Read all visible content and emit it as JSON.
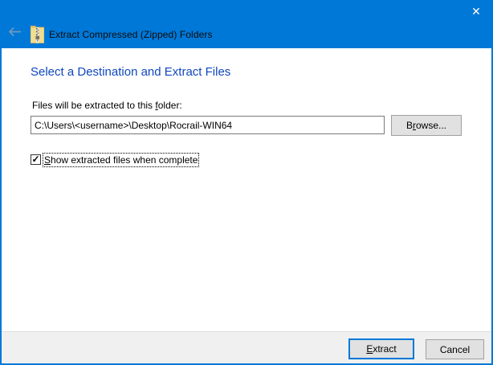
{
  "window": {
    "title": "Extract Compressed (Zipped) Folders",
    "icons": {
      "close_glyph": "✕",
      "check_glyph": "✓"
    }
  },
  "colors": {
    "titlebar": "#0078d7",
    "window_border": "#0078d7",
    "heading_text": "#0f47bd",
    "footer_bg": "#f0f0f0",
    "button_bg": "#e1e1e1",
    "default_button_border": "#0078d7"
  },
  "main": {
    "heading": "Select a Destination and Extract Files",
    "path_label": {
      "pre": "Files will be extracted to this ",
      "accel": "f",
      "post": "older:"
    },
    "path_value": "C:\\Users\\<username>\\Desktop\\Rocrail-WIN64",
    "browse_button": {
      "pre": "B",
      "accel": "r",
      "post": "owse..."
    },
    "checkbox": {
      "checked": true,
      "accel": "S",
      "post": "how extracted files when complete"
    }
  },
  "footer": {
    "extract_button": {
      "accel": "E",
      "post": "xtract"
    },
    "cancel_label": "Cancel"
  }
}
